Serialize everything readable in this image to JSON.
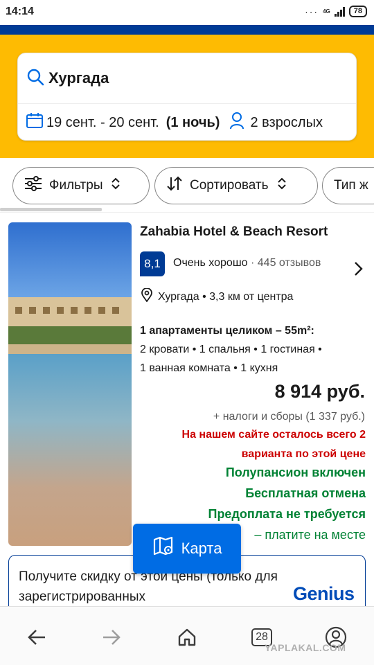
{
  "status": {
    "time": "14:14",
    "dots": "···",
    "network": "4G",
    "battery": "78"
  },
  "search": {
    "query": "Хургада",
    "dates": "19 сент. - 20 сент.",
    "nights": "(1 ночь)",
    "guests": "2 взрослых"
  },
  "toolbar": {
    "filters_label": "Фильтры",
    "sort_label": "Сортировать",
    "type_label": "Тип ж"
  },
  "hotel": {
    "name": "Zahabia Hotel & Beach Resort",
    "score": "8,1",
    "rating_label": "Очень хорошо",
    "rating_sep": "·",
    "reviews": "445 отзывов",
    "location": "Хургада • 3,3 км от центра",
    "unit_title": "1 апартаменты целиком – 55m²:",
    "unit_lines": [
      "2 кровати • 1 спальня • 1 гостиная •",
      "1 ванная комната • 1 кухня"
    ],
    "price": "8 914 руб.",
    "taxes": "+ налоги и сборы (1 337 руб.)",
    "scarcity_lines": [
      "На нашем сайте осталось всего 2",
      "варианта по этой цене"
    ],
    "perks": [
      "Полупансион включен",
      "Бесплатная отмена",
      "Предоплата не требуется",
      "– платите на месте"
    ]
  },
  "map_button": {
    "label": "Карта"
  },
  "promo": {
    "text": "Получите скидку от этой цены (только для зарегистрированных",
    "brand": "Genius"
  },
  "bottom_nav": {
    "tabs_count": "28",
    "watermark": "YAPLAKAL.COM"
  },
  "colors": {
    "brand_blue": "#003b95",
    "brand_yellow": "#febb02",
    "action_blue": "#006ce4",
    "success_green": "#008234",
    "alert_red": "#cc0000"
  }
}
